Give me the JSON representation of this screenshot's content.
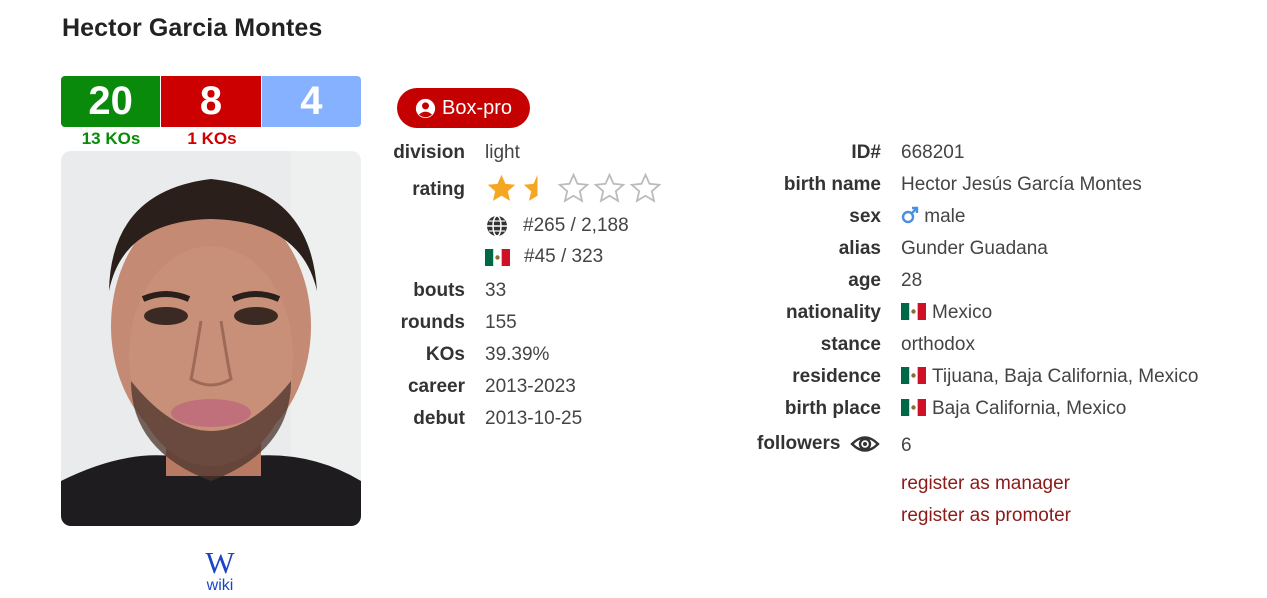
{
  "boxer": {
    "name": "Hector Garcia Montes"
  },
  "record": {
    "wins": "20",
    "losses": "8",
    "draws": "4",
    "win_kos": "13 KOs",
    "loss_kos": "1 KOs"
  },
  "colors": {
    "win": "#0a8a0a",
    "loss": "#cc0000",
    "draw": "#85b1ff",
    "badge": "#c40000",
    "link": "#8b1a1a",
    "star": "#f5a623"
  },
  "wiki": {
    "glyph": "W",
    "label": "wiki"
  },
  "badge": {
    "label": "Box-pro",
    "icon": "user-circle-icon"
  },
  "left_info": {
    "division": {
      "label": "division",
      "value": "light"
    },
    "rating": {
      "label": "rating",
      "stars_out_of_5": 1.5
    },
    "world_rank": "#265 / 2,188",
    "national_rank": "#45 / 323",
    "bouts": {
      "label": "bouts",
      "value": "33"
    },
    "rounds": {
      "label": "rounds",
      "value": "155"
    },
    "kos": {
      "label": "KOs",
      "value": "39.39%"
    },
    "career": {
      "label": "career",
      "value": "2013-2023"
    },
    "debut": {
      "label": "debut",
      "value": "2013-10-25"
    }
  },
  "right_info": {
    "id": {
      "label": "ID#",
      "value": "668201"
    },
    "birth_name": {
      "label": "birth name",
      "value": "Hector Jesús García Montes"
    },
    "sex": {
      "label": "sex",
      "value": "male"
    },
    "alias": {
      "label": "alias",
      "value": "Gunder Guadana"
    },
    "age": {
      "label": "age",
      "value": "28"
    },
    "nationality": {
      "label": "nationality",
      "value": "Mexico"
    },
    "stance": {
      "label": "stance",
      "value": "orthodox"
    },
    "residence": {
      "label": "residence",
      "value": "Tijuana, Baja California, Mexico"
    },
    "birth_place": {
      "label": "birth place",
      "value": "Baja California, Mexico"
    },
    "followers": {
      "label": "followers",
      "value": "6"
    }
  },
  "links": {
    "manager": "register as manager",
    "promoter": "register as promoter"
  }
}
